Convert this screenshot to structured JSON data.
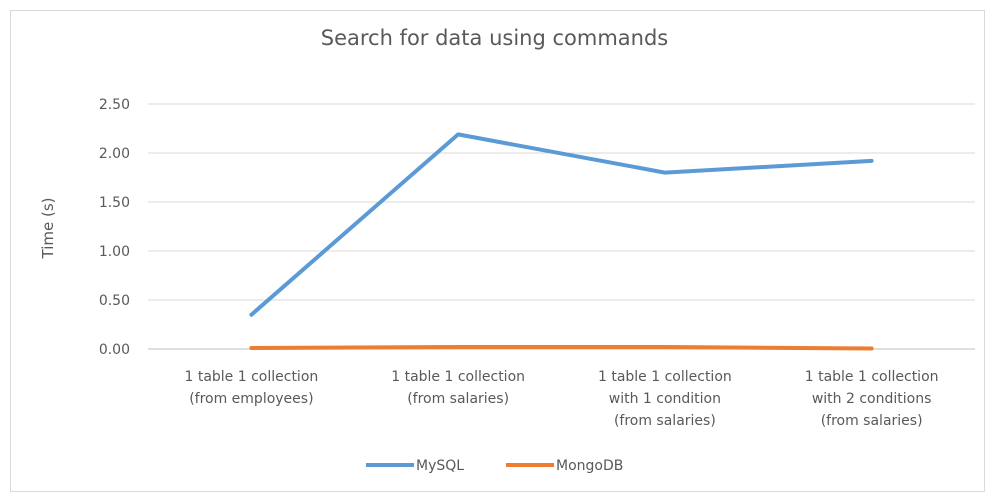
{
  "chart_data": {
    "type": "line",
    "title": "Search for data using commands",
    "xlabel": "",
    "ylabel": "Time (s)",
    "ylim": [
      0,
      2.5
    ],
    "yticks": [
      "0.00",
      "0.50",
      "1.00",
      "1.50",
      "2.00",
      "2.50"
    ],
    "categories": [
      [
        "1 table 1 collection",
        "(from employees)"
      ],
      [
        "1 table 1 collection",
        "(from salaries)"
      ],
      [
        "1 table 1 collection",
        "with 1 condition",
        "(from salaries)"
      ],
      [
        "1 table 1 collection",
        "with 2 conditions",
        "(from salaries)"
      ]
    ],
    "series": [
      {
        "name": "MySQL",
        "color": "#5b9bd5",
        "values": [
          0.35,
          2.19,
          1.8,
          1.92
        ]
      },
      {
        "name": "MongoDB",
        "color": "#ed7d31",
        "values": [
          0.01,
          0.02,
          0.02,
          0.005
        ]
      }
    ],
    "grid": true,
    "legend_position": "bottom"
  }
}
